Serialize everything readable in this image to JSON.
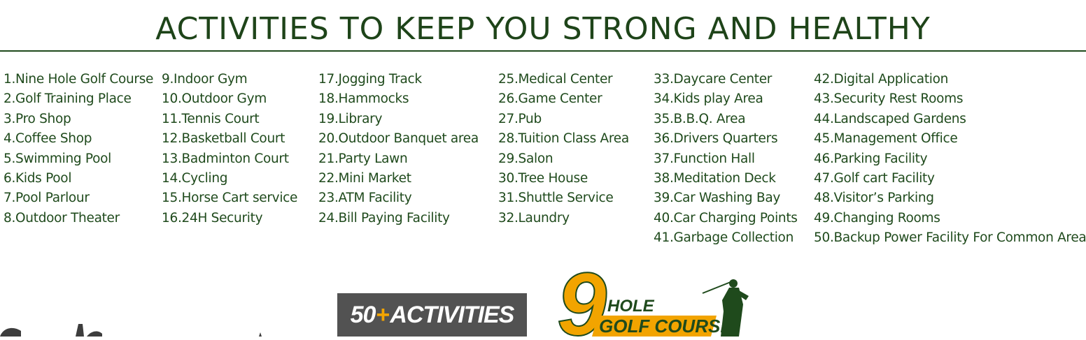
{
  "title": "ACTIVITIES TO KEEP YOU STRONG AND HEALTHY",
  "columns": [
    [
      "1.Nine Hole Golf Course",
      "2.Golf  Training Place",
      "3.Pro Shop",
      "4.Coffee Shop",
      "5.Swimming Pool",
      "6.Kids Pool",
      "7.Pool Parlour",
      "8.Outdoor Theater"
    ],
    [
      " 9.Indoor Gym",
      "10.Outdoor Gym",
      "11.Tennis Court",
      "12.Basketball Court",
      "13.Badminton Court",
      "14.Cycling",
      "15.Horse Cart service",
      "16.24H Security"
    ],
    [
      "17.Jogging Track",
      "18.Hammocks",
      "19.Library",
      "20.Outdoor Banquet area",
      "21.Party Lawn",
      "22.Mini Market",
      "23.ATM Facility",
      "24.Bill Paying Facility"
    ],
    [
      "25.Medical Center",
      "26.Game Center",
      "27.Pub",
      "28.Tuition Class Area",
      "29.Salon",
      "30.Tree House",
      "31.Shuttle Service",
      "32.Laundry"
    ],
    [
      "33.Daycare Center",
      "34.Kids play Area",
      "35.B.B.Q. Area",
      "36.Drivers Quarters",
      "37.Function Hall",
      "38.Meditation Deck",
      "39.Car Washing Bay",
      "40.Car Charging Points",
      "41.Garbage Collection"
    ],
    [
      "42.Digital Application",
      "43.Security Rest Rooms",
      "44.Landscaped Gardens",
      "45.Management Office",
      "46.Parking Facility",
      "47.Golf cart Facility",
      "48.Visitor’s Parking",
      "49.Changing Rooms",
      "50.Backup Power Facility For Common Area"
    ]
  ],
  "badge": {
    "number": "50",
    "plus": "+",
    "text": "ACTIVITIES"
  },
  "golf_logo": {
    "number": "9",
    "line1": "HOLE",
    "line2": "GOLF COURSE"
  },
  "colors": {
    "heading": "#1e4419",
    "text": "#1f4a1c",
    "badge_bg": "#525252",
    "accent": "#f2a400",
    "golf_green": "#1f4a1c"
  },
  "icons": {
    "golfer": "golfer-silhouette-icon"
  }
}
